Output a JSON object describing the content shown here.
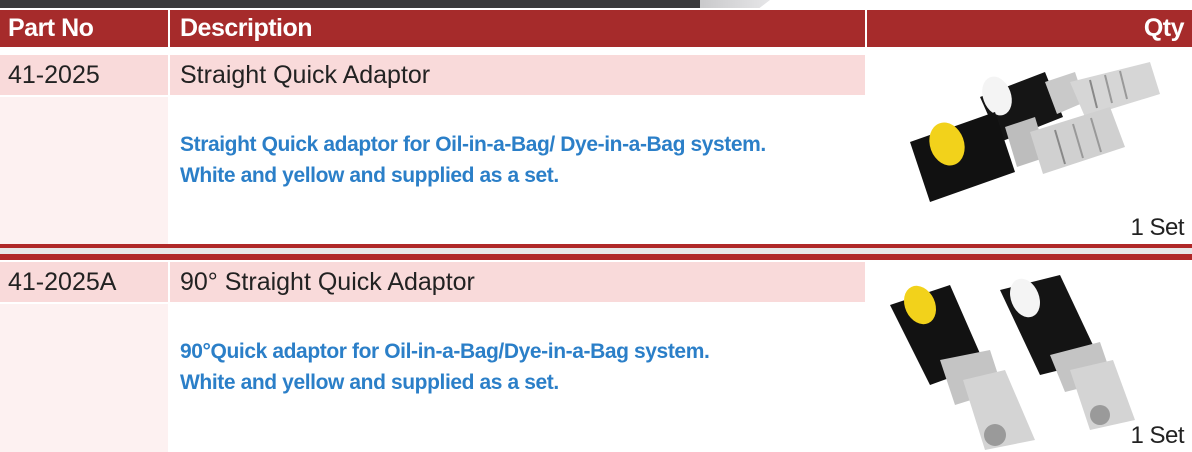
{
  "table": {
    "headers": {
      "part_no": "Part No",
      "description": "Description",
      "qty": "Qty"
    },
    "rows": [
      {
        "part_no": "41-2025",
        "title": "Straight Quick Adaptor",
        "desc_line1": "Straight Quick adaptor for Oil-in-a-Bag/ Dye-in-a-Bag system.",
        "desc_line2": "White and yellow and supplied as a set.",
        "qty": "1 Set",
        "image_icon": "straight-quick-adaptor-pair"
      },
      {
        "part_no": "41-2025A",
        "title": "90° Straight Quick Adaptor",
        "desc_line1": "90°Quick adaptor for Oil-in-a-Bag/Dye-in-a-Bag system.",
        "desc_line2": "White and yellow and supplied as a set.",
        "qty": "1 Set",
        "image_icon": "angled-quick-adaptor-pair"
      }
    ]
  },
  "colors": {
    "header_bg": "#a62b2b",
    "row_title_bg": "#f9dada",
    "description_text": "#2b7fc8",
    "banner_dark": "#3a3a3c"
  }
}
